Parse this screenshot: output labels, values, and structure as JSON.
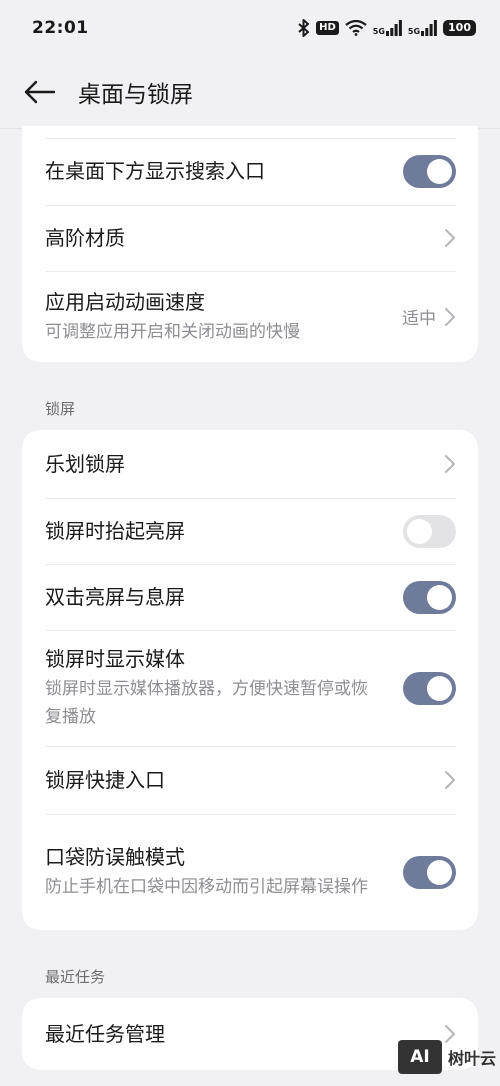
{
  "status_bar": {
    "time": "22:01",
    "hd_badge": "HD",
    "net_1": "5G",
    "net_2": "5G",
    "battery": "100"
  },
  "header": {
    "title": "桌面与锁屏"
  },
  "desktop_card": {
    "items": [
      {
        "title": "在桌面下方显示搜索入口",
        "toggle": "on"
      },
      {
        "title": "高阶材质"
      },
      {
        "title": "应用启动动画速度",
        "subtitle": "可调整应用开启和关闭动画的快慢",
        "value": "适中"
      }
    ]
  },
  "lock_section": {
    "label": "锁屏",
    "items": [
      {
        "title": "乐划锁屏"
      },
      {
        "title": "锁屏时抬起亮屏",
        "toggle": "off"
      },
      {
        "title": "双击亮屏与息屏",
        "toggle": "on"
      },
      {
        "title": "锁屏时显示媒体",
        "subtitle": "锁屏时显示媒体播放器，方便快速暂停或恢复播放",
        "toggle": "on"
      },
      {
        "title": "锁屏快捷入口"
      },
      {
        "title": "口袋防误触模式",
        "subtitle": "防止手机在口袋中因移动而引起屏幕误操作",
        "toggle": "on"
      }
    ]
  },
  "recent_section": {
    "label": "最近任务",
    "items": [
      {
        "title": "最近任务管理"
      }
    ]
  },
  "watermark": {
    "logo": "AI",
    "text": "树叶云"
  },
  "colors": {
    "toggle_on": "#6e7b9a",
    "toggle_off": "#e3e3e5",
    "background": "#f1f1f3",
    "card": "#ffffff"
  }
}
